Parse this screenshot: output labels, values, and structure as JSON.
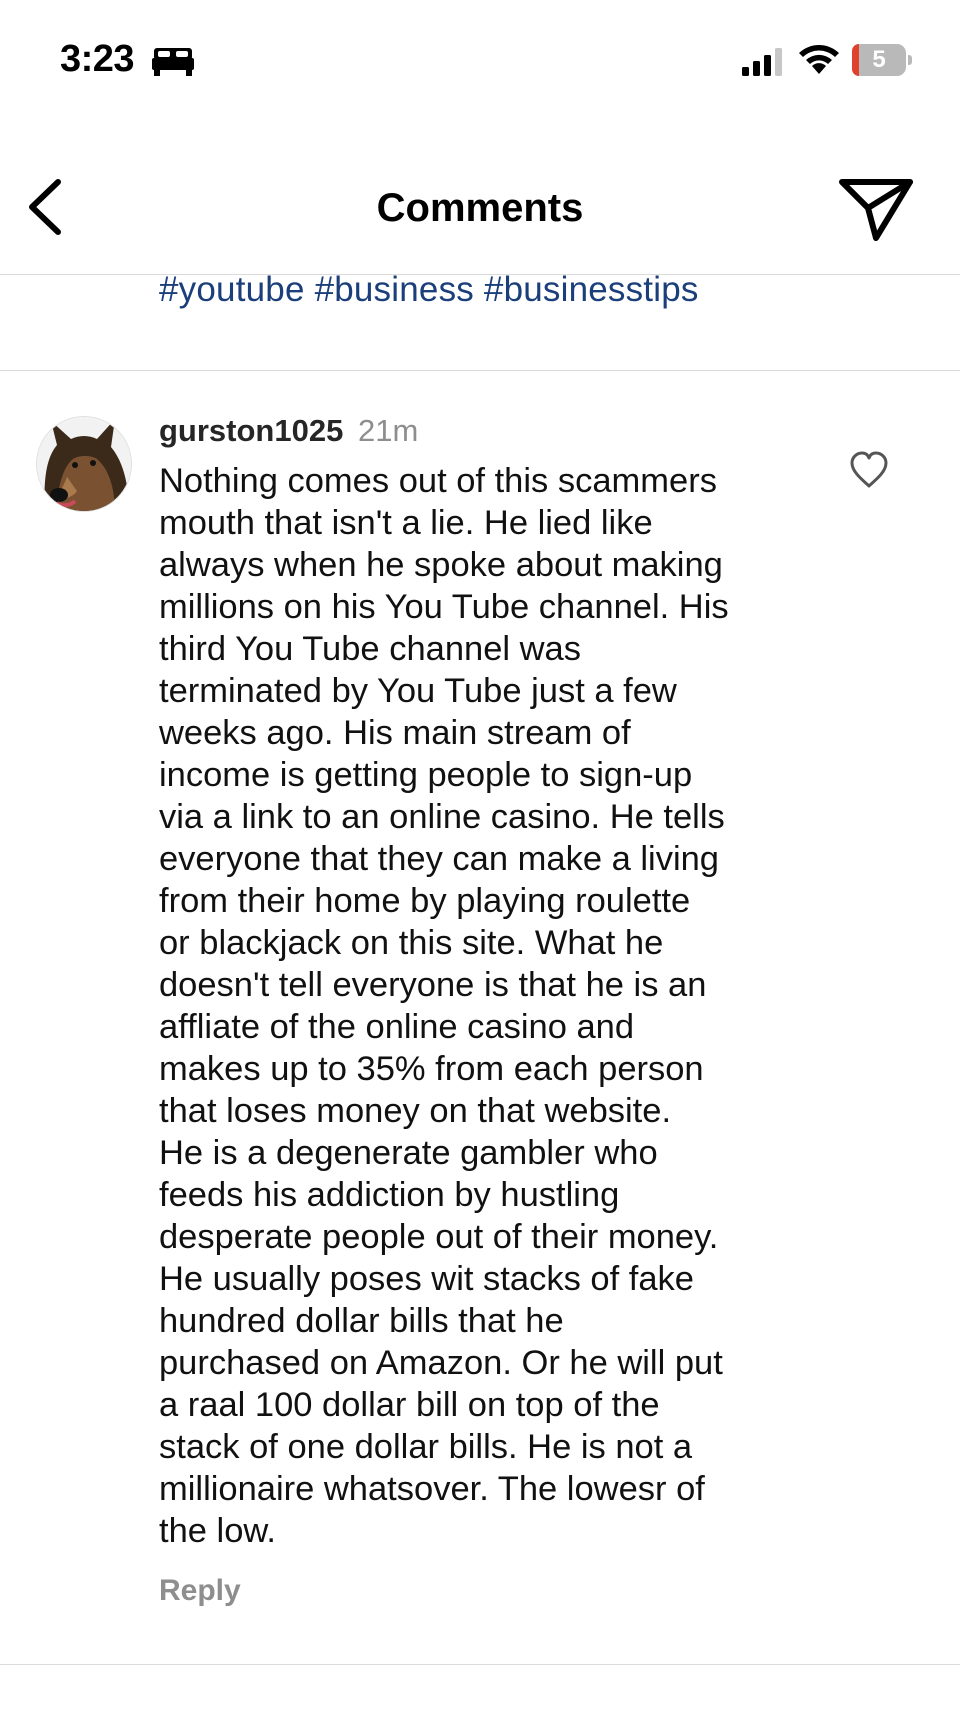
{
  "status_bar": {
    "time": "3:23",
    "battery_level": "5",
    "icons": [
      "bed-icon",
      "cellular-signal-icon",
      "wifi-icon",
      "battery-icon"
    ]
  },
  "header": {
    "title": "Comments",
    "back_icon": "chevron-left-icon",
    "share_icon": "paper-plane-icon"
  },
  "caption": {
    "hashtags": [
      "#youtube",
      "#business",
      "#businesstips"
    ]
  },
  "comment": {
    "username": "gurston1025",
    "time": "21m",
    "text": "Nothing comes out of this scammers\nmouth that isn't a lie. He lied like\nalways when he spoke about making\nmillions on his You Tube channel. His\nthird You Tube channel was\nterminated by You Tube just a few\nweeks ago. His main stream of\nincome is getting people to sign-up\nvia a link to an online casino. He tells\neveryone that they can make a living\nfrom their home by playing roulette\nor blackjack on this site. What he\ndoesn't tell everyone is that he is an\naffliate of the online casino and\nmakes up to 35% from each person\nthat loses money on that website.\nHe is a degenerate gambler who\nfeeds his addiction by hustling\ndesperate people out of their money.\nHe usually poses wit stacks of fake\nhundred dollar bills that he\npurchased on Amazon. Or he will put\na raal 100 dollar bill on top of the\nstack of one dollar bills. He is not a\nmillionaire whatsover. The lowesr of\nthe low.",
    "reply_label": "Reply",
    "like_icon": "heart-outline-icon",
    "avatar_icon": "dog-avatar"
  },
  "colors": {
    "hashtag": "#1b3f7a",
    "muted": "#8e8e8e",
    "divider": "#dbdbdb",
    "battery_low": "#e0412f"
  }
}
